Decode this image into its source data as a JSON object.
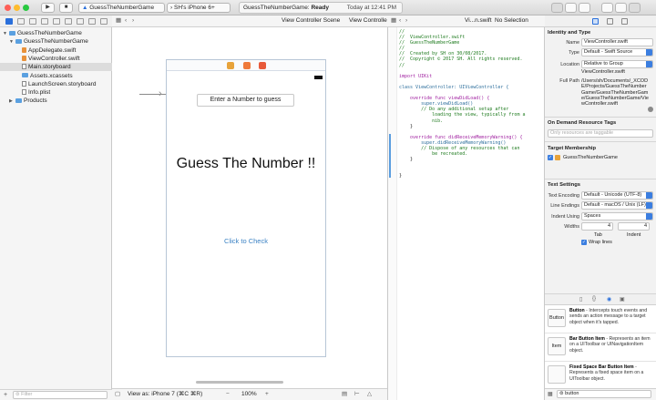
{
  "toolbar": {
    "scheme": "GuessTheNumberGame",
    "device": "SH's iPhone 6+",
    "status_title": "GuessTheNumberGame:",
    "status_state": "Ready",
    "status_time": "Today at 12:41 PM",
    "traffic_colors": [
      "#ff5f57",
      "#febc2e",
      "#28c840"
    ]
  },
  "navigator": {
    "items": [
      {
        "label": "GuessTheNumberGame",
        "indent": 0,
        "icon": "project-icon",
        "open": true
      },
      {
        "label": "GuessTheNumberGame",
        "indent": 1,
        "icon": "folder-icon",
        "open": true
      },
      {
        "label": "AppDelegate.swift",
        "indent": 2,
        "icon": "swift-icon"
      },
      {
        "label": "ViewController.swift",
        "indent": 2,
        "icon": "swift-icon"
      },
      {
        "label": "Main.storyboard",
        "indent": 2,
        "icon": "storyboard-icon",
        "selected": true
      },
      {
        "label": "Assets.xcassets",
        "indent": 2,
        "icon": "folder-icon"
      },
      {
        "label": "LaunchScreen.storyboard",
        "indent": 2,
        "icon": "storyboard-icon"
      },
      {
        "label": "Info.plist",
        "indent": 2,
        "icon": "plist-icon"
      },
      {
        "label": "Products",
        "indent": 1,
        "icon": "folder-icon",
        "open": false
      }
    ],
    "filter_placeholder": "Filter"
  },
  "canvas": {
    "jumpbar": "View Controller Scene",
    "jumpbar_end": "View Controller",
    "label_enter": "Enter a Number to guess",
    "title": "Guess The Number !!",
    "button": "Click to Check",
    "view_as": "View as: iPhone 7 (⌘C ⌘R)",
    "zoom": "100%",
    "accent": "#3b82c4"
  },
  "editor": {
    "jumpbar_file": "Vi...n.swift",
    "jumpbar_sel": "No Selection",
    "code_lines": [
      {
        "t": "//",
        "c": "cm"
      },
      {
        "t": "//  ViewController.swift",
        "c": "cm"
      },
      {
        "t": "//  GuessTheNumberGame",
        "c": "cm"
      },
      {
        "t": "//",
        "c": "cm"
      },
      {
        "t": "//  Created by SH on 30/08/2017.",
        "c": "cm"
      },
      {
        "t": "//  Copyright © 2017 SH. All rights reserved.",
        "c": "cm"
      },
      {
        "t": "//",
        "c": "cm"
      },
      {
        "t": "",
        "c": ""
      },
      {
        "t": "import UIKit",
        "c": "kw"
      },
      {
        "t": "",
        "c": ""
      },
      {
        "t": "class ViewController: UIViewController {",
        "c": "cl"
      },
      {
        "t": "",
        "c": ""
      },
      {
        "t": "    override func viewDidLoad() {",
        "c": "kw"
      },
      {
        "t": "        super.viewDidLoad()",
        "c": "cl"
      },
      {
        "t": "        // Do any additional setup after",
        "c": "cm"
      },
      {
        "t": "            loading the view, typically from a",
        "c": "cm"
      },
      {
        "t": "            nib.",
        "c": "cm"
      },
      {
        "t": "    }",
        "c": ""
      },
      {
        "t": "",
        "c": ""
      },
      {
        "t": "    override func didReceiveMemoryWarning() {",
        "c": "kw"
      },
      {
        "t": "        super.didReceiveMemoryWarning()",
        "c": "cl"
      },
      {
        "t": "        // Dispose of any resources that can",
        "c": "cm"
      },
      {
        "t": "            be recreated.",
        "c": "cm"
      },
      {
        "t": "    }",
        "c": ""
      },
      {
        "t": "",
        "c": ""
      },
      {
        "t": "",
        "c": ""
      },
      {
        "t": "}",
        "c": ""
      }
    ]
  },
  "inspector": {
    "identity_header": "Identity and Type",
    "name_label": "Name",
    "name_value": "ViewController.swift",
    "type_label": "Type",
    "type_value": "Default - Swift Source",
    "location_label": "Location",
    "location_value": "Relative to Group",
    "location_file": "ViewController.swift",
    "fullpath_label": "Full Path",
    "fullpath_value": "/Users/sh/Documents/_XCODE/Projects/GuessTheNumberGame/GuessTheNumberGame/GuessTheNumberGame/ViewController.swift",
    "odr_header": "On Demand Resource Tags",
    "odr_placeholder": "Only resources are taggable",
    "target_header": "Target Membership",
    "target_item": "GuessTheNumberGame",
    "text_header": "Text Settings",
    "encoding_label": "Text Encoding",
    "encoding_value": "Default - Unicode (UTF-8)",
    "endings_label": "Line Endings",
    "endings_value": "Default - macOS / Unix (LF)",
    "indent_label": "Indent Using",
    "indent_value": "Spaces",
    "widths_label": "Widths",
    "tab_value": "4",
    "indent_width_value": "4",
    "tab_label": "Tab",
    "indent_caption": "Indent",
    "wrap_label": "Wrap lines",
    "library": [
      {
        "icon": "Button",
        "title": "Button",
        "desc": "Intercepts touch events and sends an action message to a target object when it's tapped."
      },
      {
        "icon": "Item",
        "title": "Bar Button Item",
        "desc": "Represents an item on a UIToolbar or UINavigationItem object."
      },
      {
        "icon": "",
        "title": "Fixed Space Bar Button Item",
        "desc": "Represents a fixed space item on a UIToolbar object."
      }
    ],
    "filter_value": "button"
  }
}
